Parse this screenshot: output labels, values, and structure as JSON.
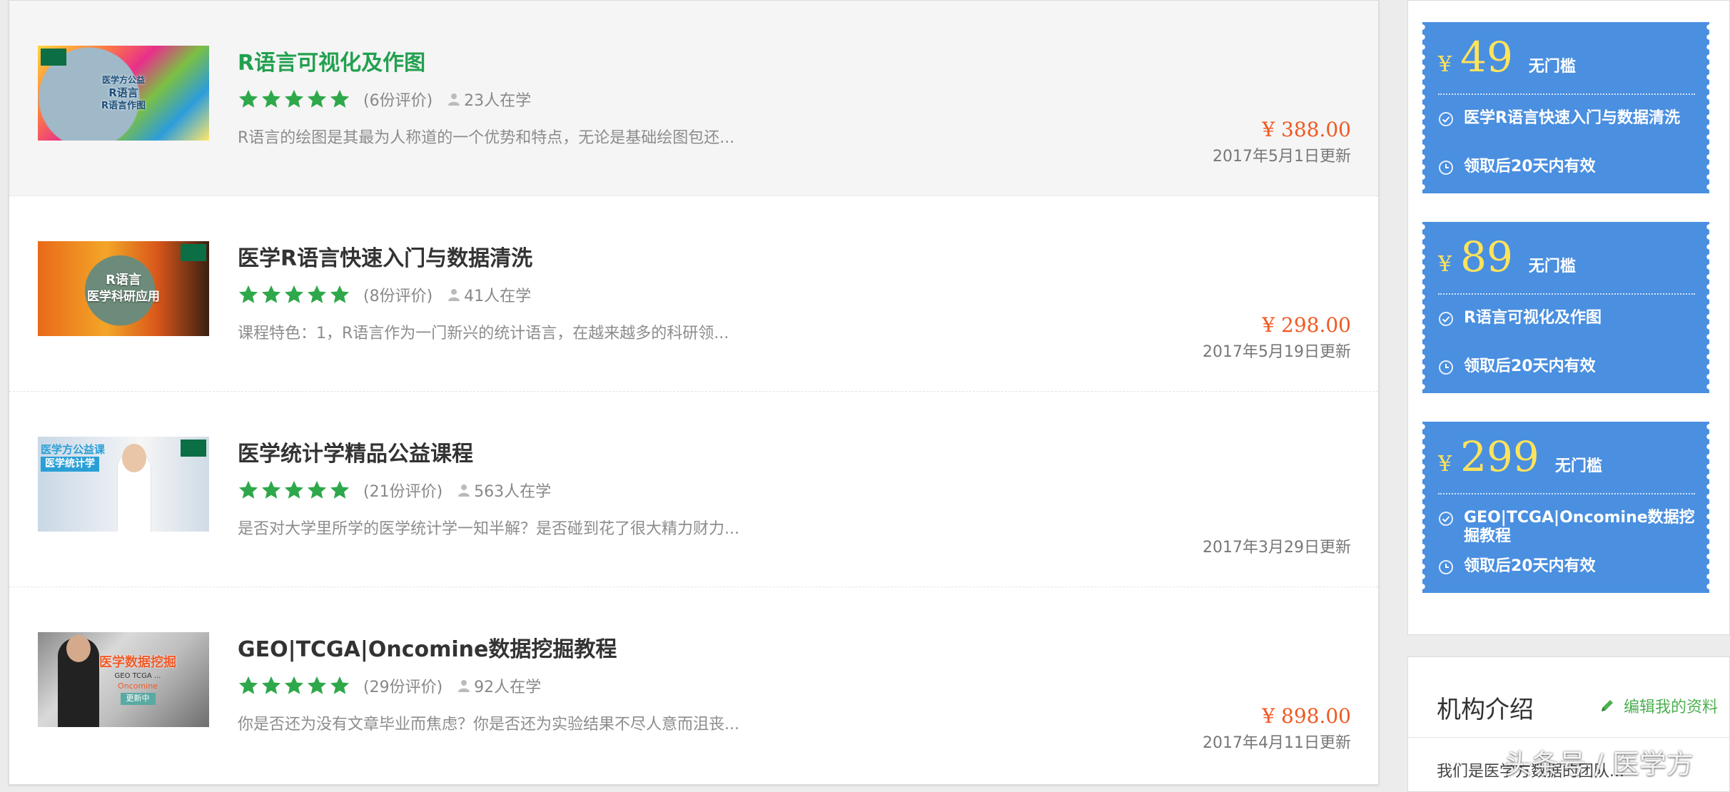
{
  "courses": [
    {
      "title": "R语言可视化及作图",
      "reviews": "(6份评价)",
      "learners": "23人在学",
      "description": "R语言的绘图是其最为人称道的一个优势和特点，无论是基础绘图包还...",
      "price": "¥ 388.00",
      "updated": "2017年5月1日更新",
      "rating": 5,
      "thumb_lines": [
        "医学方公益",
        "R语言",
        "R语言作图"
      ]
    },
    {
      "title": "医学R语言快速入门与数据清洗",
      "reviews": "(8份评价)",
      "learners": "41人在学",
      "description": "课程特色：1，R语言作为一门新兴的统计语言，在越来越多的科研领...",
      "price": "¥ 298.00",
      "updated": "2017年5月19日更新",
      "rating": 5,
      "thumb_lines": [
        "R语言",
        "医学科研应用"
      ]
    },
    {
      "title": "医学统计学精品公益课程",
      "reviews": "(21份评价)",
      "learners": "563人在学",
      "description": "是否对大学里所学的医学统计学一知半解？是否碰到花了很大精力财力...",
      "price": "",
      "updated": "2017年3月29日更新",
      "rating": 5,
      "thumb_lines": [
        "医学方公益课",
        "医学统计学"
      ]
    },
    {
      "title": "GEO|TCGA|Oncomine数据挖掘教程",
      "reviews": "(29份评价)",
      "learners": "92人在学",
      "description": "你是否还为没有文章毕业而焦虑？你是否还为实验结果不尽人意而沮丧...",
      "price": "¥ 898.00",
      "updated": "2017年4月11日更新",
      "rating": 5,
      "thumb_lines": [
        "医学数据挖掘",
        "GEO  TCGA  ...",
        "Oncomine",
        "更新中"
      ]
    }
  ],
  "coupons": [
    {
      "yen": "¥",
      "amount": "49",
      "threshold": "无门槛",
      "course": "医学R语言快速入门与数据清洗",
      "validity": "领取后20天内有效"
    },
    {
      "yen": "¥",
      "amount": "89",
      "threshold": "无门槛",
      "course": "R语言可视化及作图",
      "validity": "领取后20天内有效"
    },
    {
      "yen": "¥",
      "amount": "299",
      "threshold": "无门槛",
      "course": "GEO|TCGA|Oncomine数据挖掘教程",
      "validity": "领取后20天内有效"
    }
  ],
  "intro": {
    "title": "机构介绍",
    "edit_label": "编辑我的资料",
    "text": "我们是医学方数据的团队..."
  },
  "watermark": "头条号 / 医学方",
  "colors": {
    "price": "#ef5a23",
    "star": "#2ea84a",
    "coupon_bg": "#4a8fe0",
    "coupon_amount": "#ffe35a",
    "title_hover": "#22a04f"
  }
}
